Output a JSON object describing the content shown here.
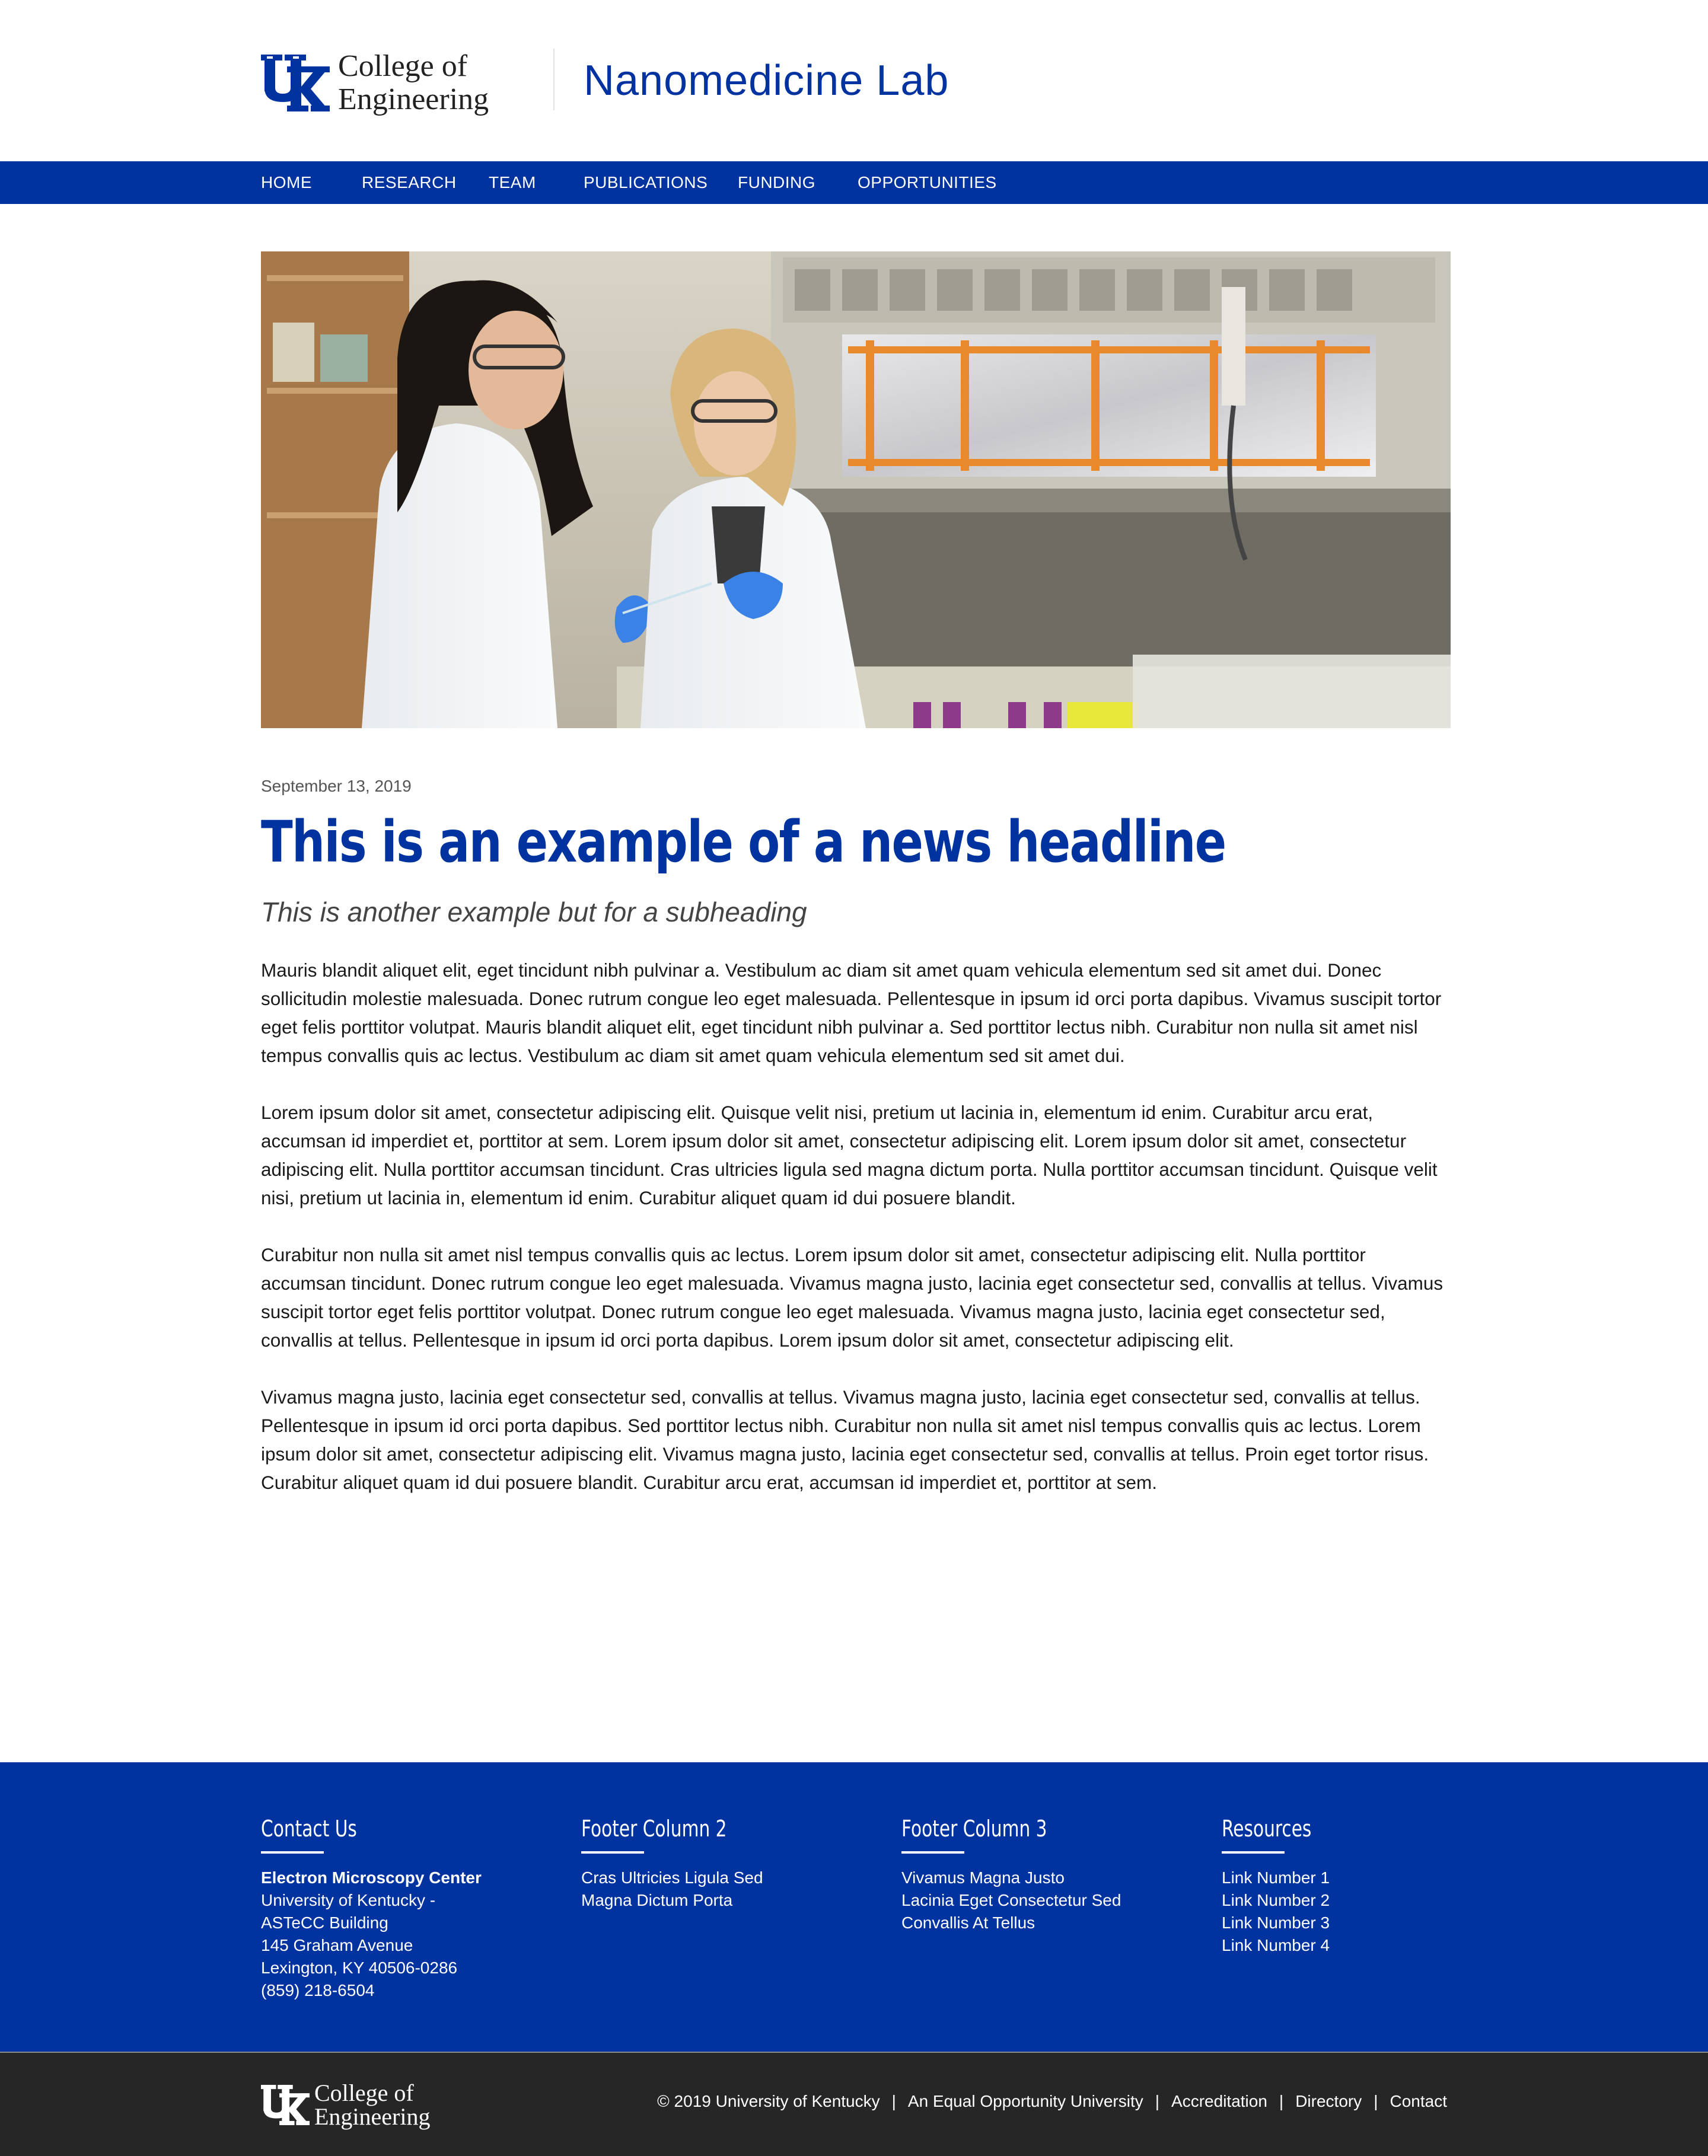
{
  "header": {
    "college_line1": "College of",
    "college_line2": "Engineering",
    "site_title": "Nanomedicine Lab"
  },
  "nav": {
    "items": [
      "HOME",
      "RESEARCH",
      "TEAM",
      "PUBLICATIONS",
      "FUNDING",
      "OPPORTUNITIES"
    ]
  },
  "article": {
    "date": "September 13, 2019",
    "headline": "This is an example of a news headline",
    "subheading": "This is another example but for a subheading",
    "paragraphs": [
      "Mauris blandit aliquet elit, eget tincidunt nibh pulvinar a. Vestibulum ac diam sit amet quam vehicula elementum sed sit amet dui. Donec sollicitudin molestie malesuada. Donec rutrum congue leo eget malesuada. Pellentesque in ipsum id orci porta dapibus. Vivamus suscipit tortor eget felis porttitor volutpat. Mauris blandit aliquet elit, eget tincidunt nibh pulvinar a. Sed porttitor lectus nibh. Curabitur non nulla sit amet nisl tempus convallis quis ac lectus. Vestibulum ac diam sit amet quam vehicula elementum sed sit amet dui.",
      "Lorem ipsum dolor sit amet, consectetur adipiscing elit. Quisque velit nisi, pretium ut lacinia in, elementum id enim. Curabitur arcu erat, accumsan id imperdiet et, porttitor at sem. Lorem ipsum dolor sit amet, consectetur adipiscing elit. Lorem ipsum dolor sit amet, consectetur adipiscing elit. Nulla porttitor accumsan tincidunt. Cras ultricies ligula sed magna dictum porta. Nulla porttitor accumsan tincidunt. Quisque velit nisi, pretium ut lacinia in, elementum id enim. Curabitur aliquet quam id dui posuere blandit.",
      "Curabitur non nulla sit amet nisl tempus convallis quis ac lectus. Lorem ipsum dolor sit amet, consectetur adipiscing elit. Nulla porttitor accumsan tincidunt. Donec rutrum congue leo eget malesuada. Vivamus magna justo, lacinia eget consectetur sed, convallis at tellus. Vivamus suscipit tortor eget felis porttitor volutpat. Donec rutrum congue leo eget malesuada. Vivamus magna justo, lacinia eget consectetur sed, convallis at tellus. Pellentesque in ipsum id orci porta dapibus. Lorem ipsum dolor sit amet, consectetur adipiscing elit.",
      "Vivamus magna justo, lacinia eget consectetur sed, convallis at tellus. Vivamus magna justo, lacinia eget consectetur sed, convallis at tellus. Pellentesque in ipsum id orci porta dapibus. Sed porttitor lectus nibh. Curabitur non nulla sit amet nisl tempus convallis quis ac lectus. Lorem ipsum dolor sit amet, consectetur adipiscing elit. Vivamus magna justo, lacinia eget consectetur sed, convallis at tellus. Proin eget tortor risus. Curabitur aliquet quam id dui posuere blandit. Curabitur arcu erat, accumsan id imperdiet et, porttitor at sem."
    ]
  },
  "footer": {
    "columns": [
      {
        "title": "Contact Us",
        "strong": "Electron Microscopy Center",
        "lines": [
          "University of Kentucky -",
          "ASTeCC Building",
          "145 Graham Avenue",
          "Lexington, KY 40506-0286",
          "(859) 218-6504"
        ]
      },
      {
        "title": "Footer Column 2",
        "lines": [
          "Cras Ultricies Ligula Sed",
          "Magna Dictum Porta"
        ]
      },
      {
        "title": "Footer Column 3",
        "lines": [
          "Vivamus Magna Justo",
          "Lacinia Eget Consectetur Sed",
          "Convallis At Tellus"
        ]
      },
      {
        "title": "Resources",
        "lines": [
          "Link Number 1",
          "Link Number 2",
          "Link Number 3",
          "Link Number 4"
        ]
      }
    ],
    "bottom": {
      "college_line1": "College of",
      "college_line2": "Engineering",
      "copyright": "© 2019 University of Kentucky",
      "links": [
        "An Equal Opportunity University",
        "Accreditation",
        "Directory",
        "Contact"
      ],
      "separator": "|"
    }
  },
  "colors": {
    "brand_blue": "#0033a0",
    "footer_dark": "#262626"
  }
}
